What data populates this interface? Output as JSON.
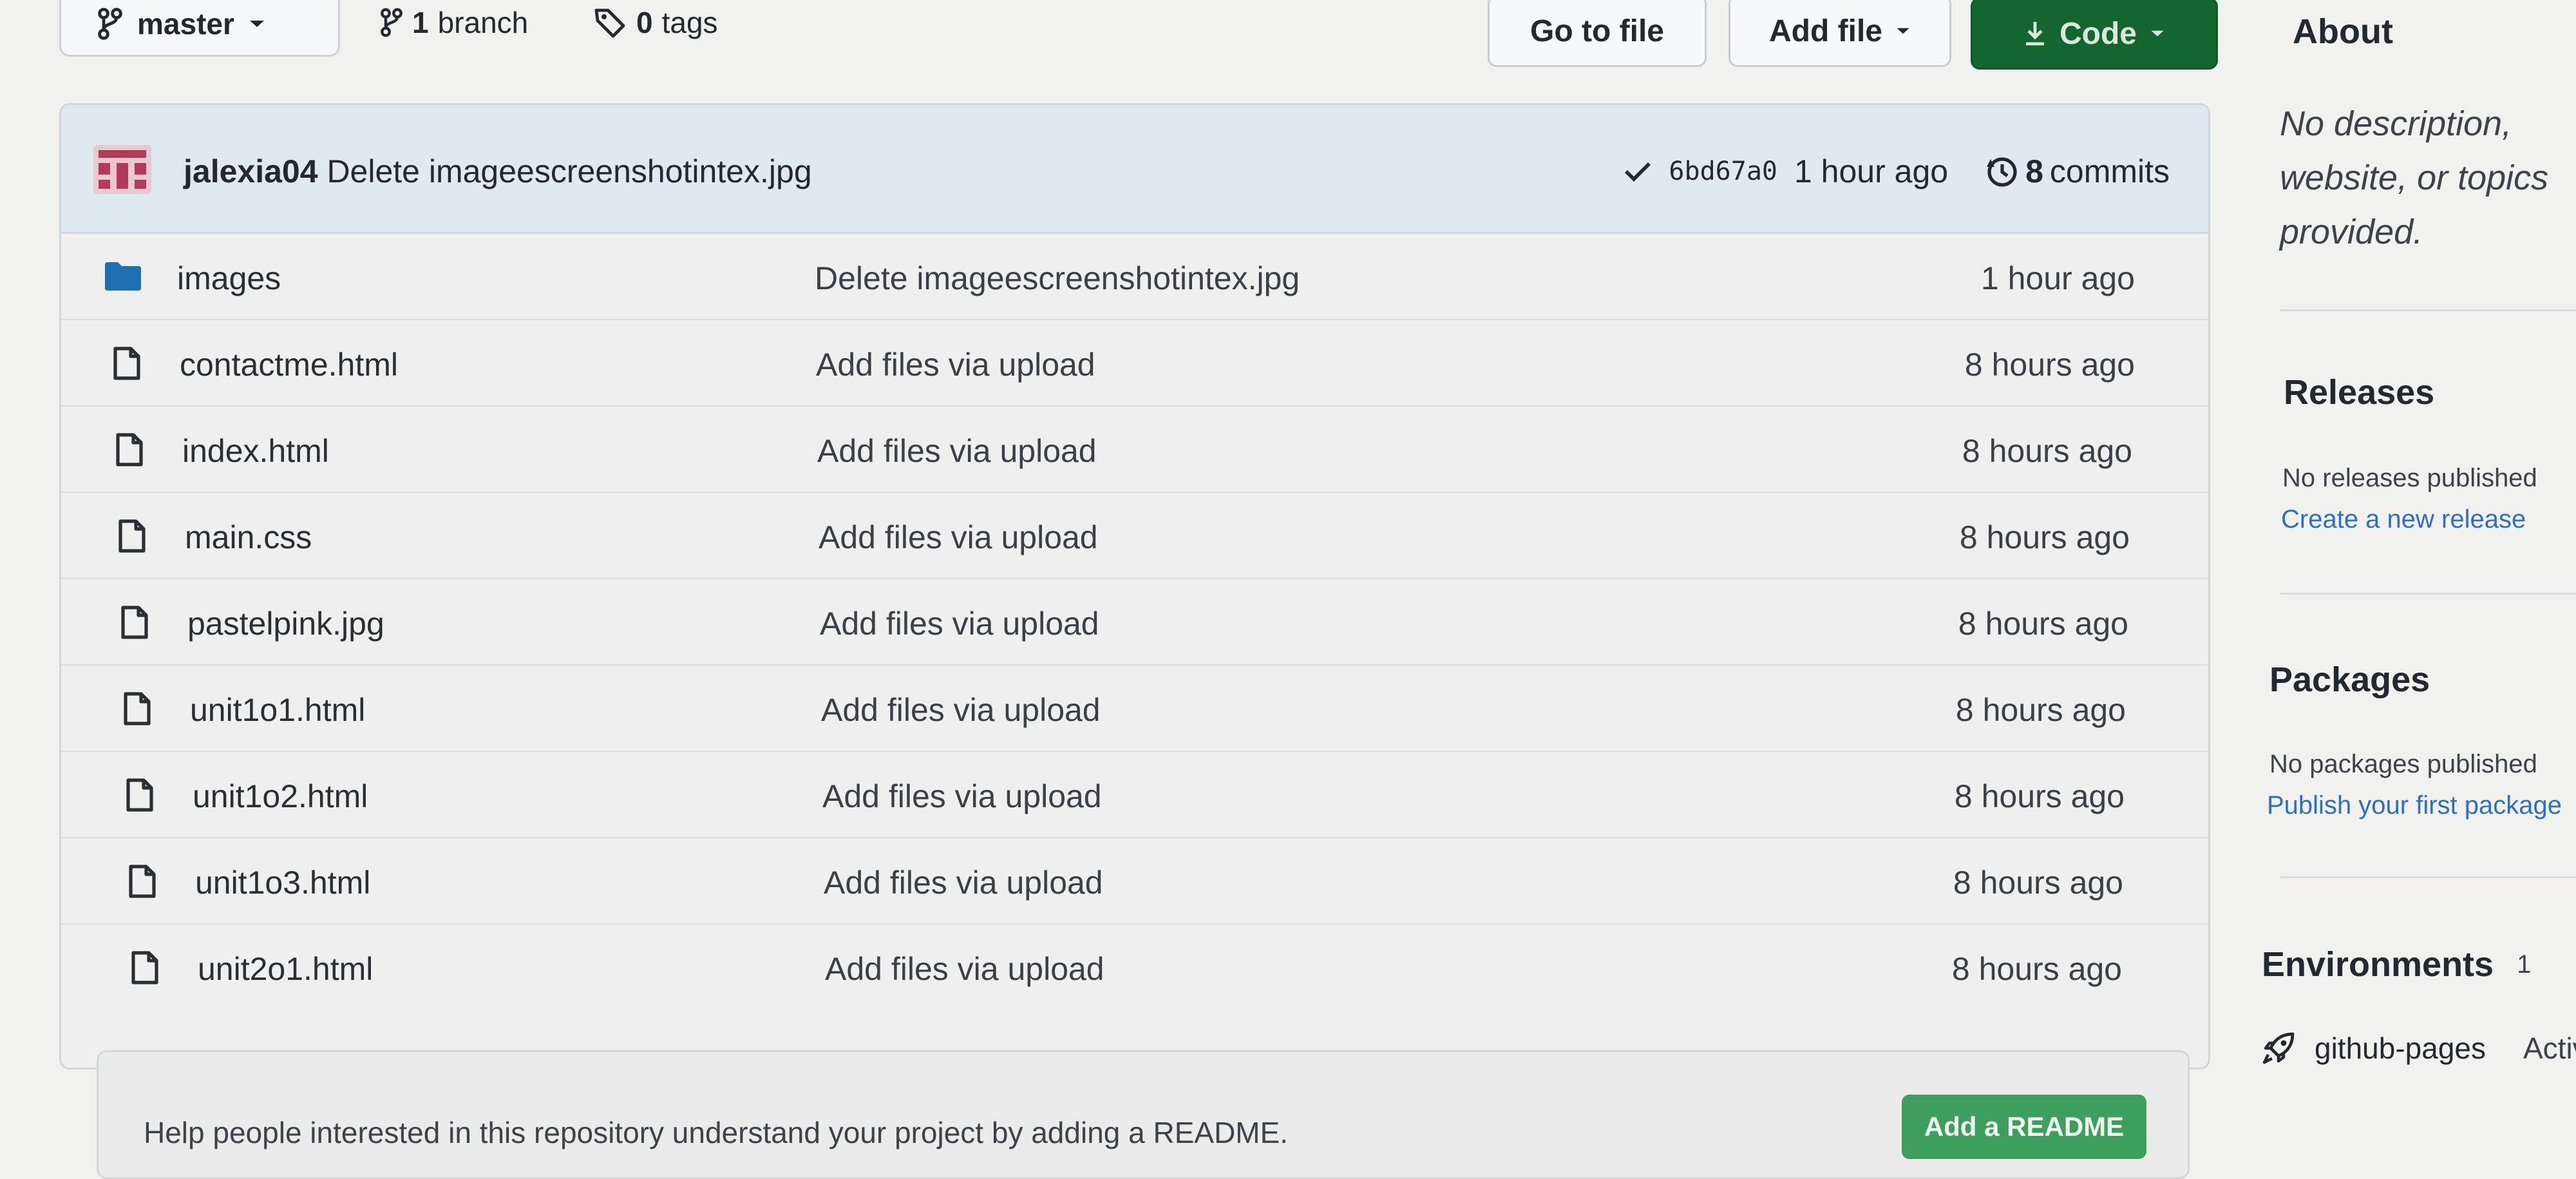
{
  "branch": {
    "name": "master"
  },
  "repo_meta": {
    "branches_count": "1",
    "branches_label": "branch",
    "tags_count": "0",
    "tags_label": "tags"
  },
  "buttons": {
    "go_to_file": "Go to file",
    "add_file": "Add file",
    "code": "Code"
  },
  "latest_commit": {
    "author": "jalexia04",
    "message": "Delete imageescreenshotintex.jpg",
    "sha": "6bd67a0",
    "time": "1 hour ago",
    "commits_count": "8",
    "commits_label": "commits"
  },
  "files": [
    {
      "name": "images",
      "type": "dir",
      "message": "Delete imageescreenshotintex.jpg",
      "age": "1 hour ago"
    },
    {
      "name": "contactme.html",
      "type": "file",
      "message": "Add files via upload",
      "age": "8 hours ago"
    },
    {
      "name": "index.html",
      "type": "file",
      "message": "Add files via upload",
      "age": "8 hours ago"
    },
    {
      "name": "main.css",
      "type": "file",
      "message": "Add files via upload",
      "age": "8 hours ago"
    },
    {
      "name": "pastelpink.jpg",
      "type": "file",
      "message": "Add files via upload",
      "age": "8 hours ago"
    },
    {
      "name": "unit1o1.html",
      "type": "file",
      "message": "Add files via upload",
      "age": "8 hours ago"
    },
    {
      "name": "unit1o2.html",
      "type": "file",
      "message": "Add files via upload",
      "age": "8 hours ago"
    },
    {
      "name": "unit1o3.html",
      "type": "file",
      "message": "Add files via upload",
      "age": "8 hours ago"
    },
    {
      "name": "unit2o1.html",
      "type": "file",
      "message": "Add files via upload",
      "age": "8 hours ago"
    }
  ],
  "readme": {
    "text": "Help people interested in this repository understand your project by adding a README.",
    "button": "Add a README"
  },
  "about": {
    "title": "About",
    "description": "No description, website, or topics provided."
  },
  "releases": {
    "title": "Releases",
    "empty": "No releases published",
    "link": "Create a new release"
  },
  "packages": {
    "title": "Packages",
    "empty": "No packages published",
    "link": "Publish your first package"
  },
  "environments": {
    "title": "Environments",
    "count": "1",
    "items": [
      {
        "name": "github-pages",
        "status": "Active"
      }
    ]
  },
  "colors": {
    "code_button": "#14652e",
    "readme_button": "#3e9e5e",
    "folder_icon": "#1f6fb2",
    "link": "#2f6fc0",
    "commit_bar": "#dfe9f1"
  }
}
